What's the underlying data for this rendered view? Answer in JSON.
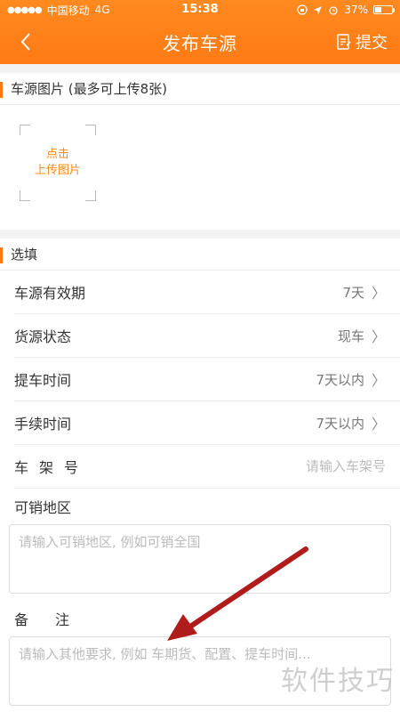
{
  "status_bar": {
    "carrier": "中国移动",
    "network": "4G",
    "time": "15:38",
    "battery": "37%",
    "battery_level": 0.37
  },
  "nav": {
    "title": "发布车源",
    "submit_label": "提交"
  },
  "photos": {
    "heading": "车源图片 (最多可上传8张)",
    "upload_line1": "点击",
    "upload_line2": "上传图片"
  },
  "optional": {
    "heading": "选填",
    "rows": [
      {
        "label": "车源有效期",
        "value": "7天"
      },
      {
        "label": "货源状态",
        "value": "现车"
      },
      {
        "label": "提车时间",
        "value": "7天以内"
      },
      {
        "label": "手续时间",
        "value": "7天以内"
      }
    ],
    "vin": {
      "label": "车架号",
      "placeholder": "请输入车架号"
    },
    "region": {
      "label": "可销地区",
      "placeholder": "请输入可销地区, 例如可销全国"
    },
    "remark": {
      "label": "备注",
      "placeholder": "请输入其他要求, 例如 车期货、配置、提车时间..."
    }
  },
  "watermark": "软件技巧",
  "colors": {
    "accent": "#ff7a14",
    "annotation_arrow": "#b01c1c"
  }
}
